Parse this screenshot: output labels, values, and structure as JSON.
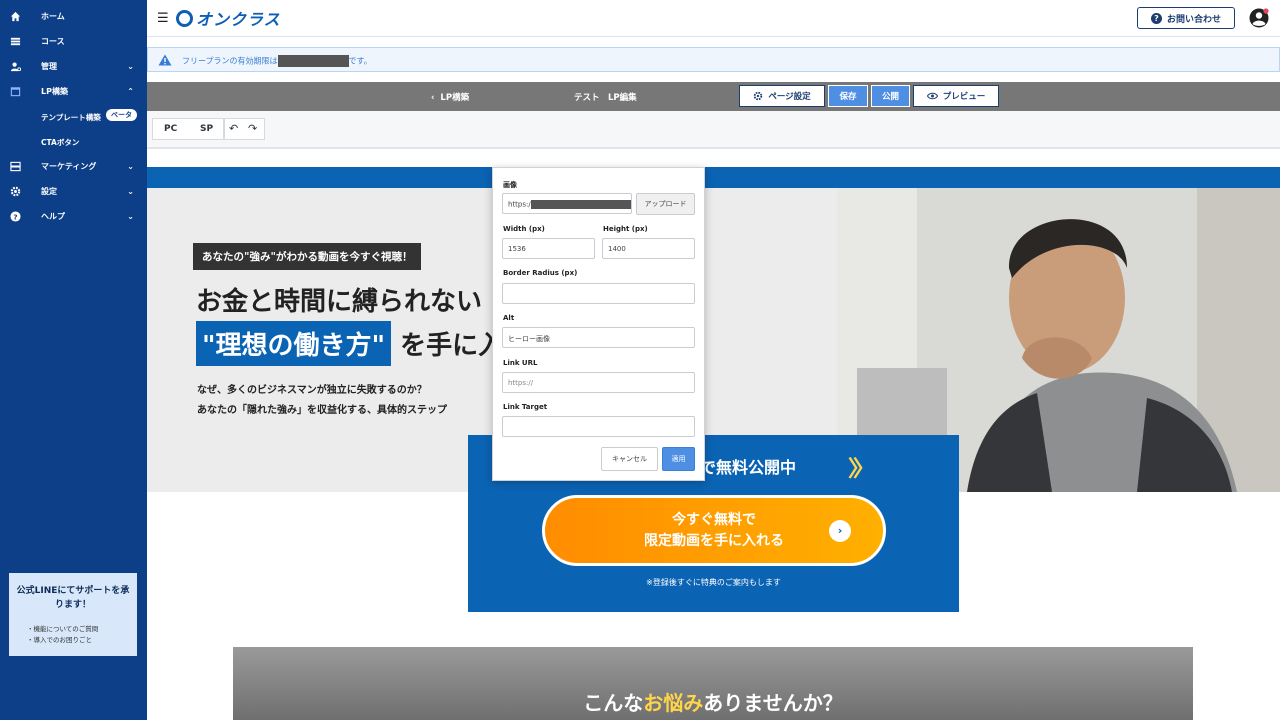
{
  "sidebar": {
    "items": [
      {
        "label": "ホーム",
        "icon": "home-icon",
        "chevron": ""
      },
      {
        "label": "コース",
        "icon": "list-icon",
        "chevron": ""
      },
      {
        "label": "管理",
        "icon": "user-cog-icon",
        "chevron": "⌄"
      },
      {
        "label": "LP構築",
        "icon": "calendar-icon",
        "chevron": "⌃"
      }
    ],
    "sub_items": [
      {
        "label": "テンプレート構築",
        "badge": "ベータ"
      },
      {
        "label": "CTAボタン"
      }
    ],
    "items2": [
      {
        "label": "マーケティング",
        "icon": "server-icon",
        "chevron": "⌄"
      },
      {
        "label": "設定",
        "icon": "gear-icon",
        "chevron": "⌄"
      },
      {
        "label": "ヘルプ",
        "icon": "help-icon",
        "chevron": "⌄"
      }
    ],
    "line_box": {
      "title_line1": "公式LINEにてサポートを承",
      "title_line2": "ります！",
      "list": [
        "・機能についてのご質問",
        "・導入でのお困りごと"
      ]
    }
  },
  "header": {
    "logo": "オンクラス",
    "contact_button": "お問い合わせ"
  },
  "notice": {
    "before": "フリープランの有効期限は",
    "after": "です。"
  },
  "editbar": {
    "back": "LP構築",
    "page_name": "テスト　LP編集",
    "settings": "ページ設定",
    "save": "保存",
    "publish": "公開",
    "preview": "プレビュー"
  },
  "device": {
    "pc": "PC",
    "sp": "SP"
  },
  "hero": {
    "badge": "あなたの\"強み\"がわかる動画を今すぐ視聴！",
    "h1": "お金と時間に縛られない",
    "h2_highlight": "\"理想の働き方\"",
    "h2_rest": " を手に入",
    "sub1": "なぜ、多くのビジネスマンが独立に失敗するのか？",
    "sub2": "あなたの「隠れた強み」を収益化する、具体的ステップ"
  },
  "cta": {
    "heading": "で無料公開中",
    "button_line1": "今すぐ無料で",
    "button_line2": "限定動画を手に入れる",
    "note": "※登録後すぐに特典のご案内もします"
  },
  "section2": {
    "title_pre": "こんな",
    "title_em": "お悩み",
    "title_post": "ありませんか？"
  },
  "popup": {
    "image_label": "画像",
    "image_url_prefix": "https:/",
    "upload": "アップロード",
    "width_label": "Width (px)",
    "width_value": "1536",
    "height_label": "Height (px)",
    "height_value": "1400",
    "radius_label": "Border Radius (px)",
    "radius_value": "",
    "alt_label": "Alt",
    "alt_value": "ヒーロー画像",
    "link_url_label": "Link URL",
    "link_url_placeholder": "https://",
    "link_target_label": "Link Target",
    "link_target_value": "",
    "cancel": "キャンセル",
    "apply": "適用"
  },
  "colors": {
    "sidebar": "#0d3f88",
    "brand_blue": "#0b63b4",
    "cta_orange": "#ff8c00",
    "accent_yellow": "#ffd64a"
  }
}
